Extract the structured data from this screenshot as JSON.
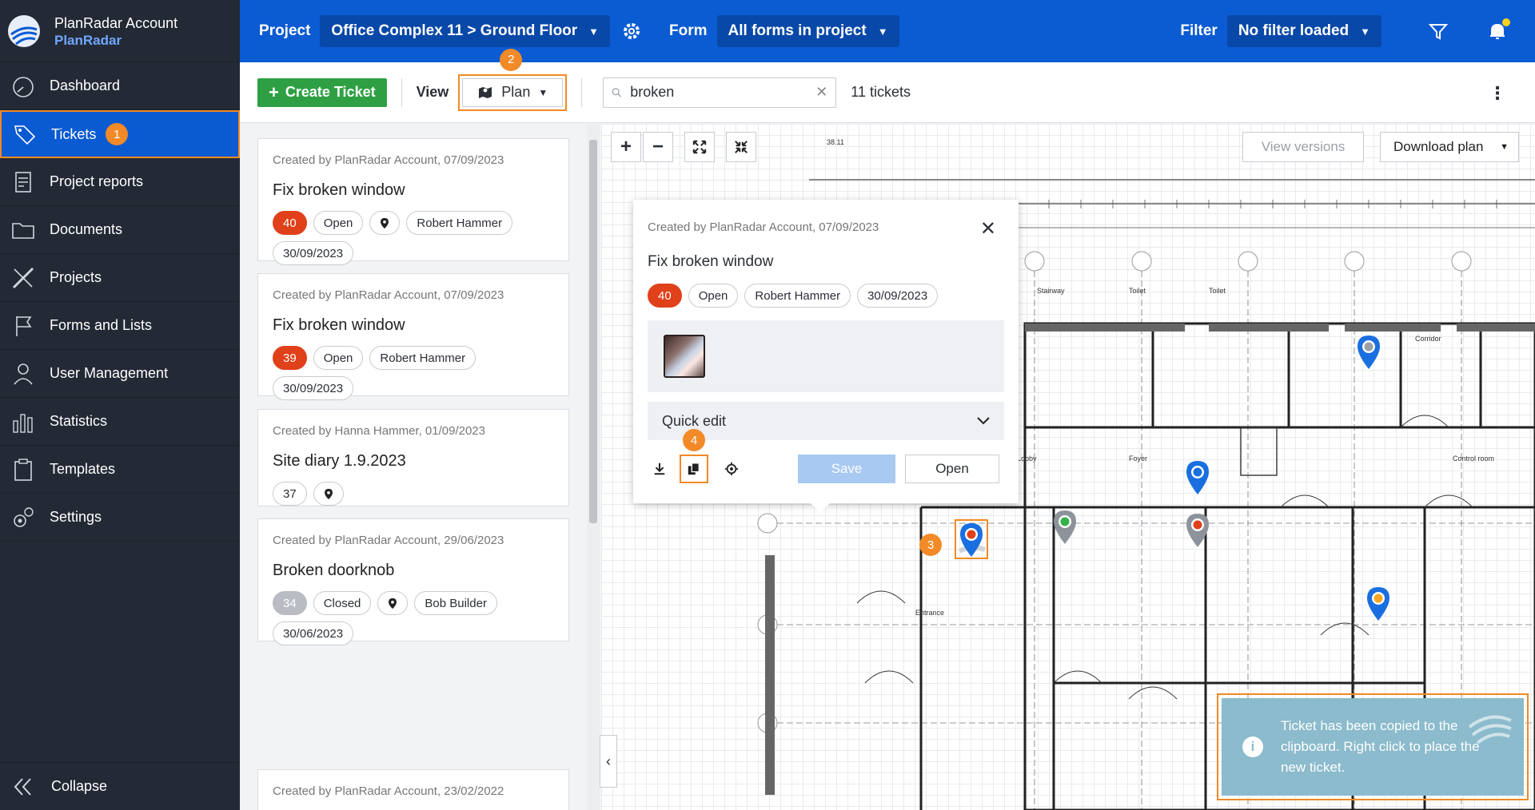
{
  "sidebar": {
    "brand_title": "PlanRadar Account",
    "brand_sub": "PlanRadar",
    "items": [
      {
        "label": "Dashboard",
        "icon": "dashboard-icon"
      },
      {
        "label": "Tickets",
        "icon": "tag-icon",
        "active": true,
        "badge": "1"
      },
      {
        "label": "Project reports",
        "icon": "report-icon"
      },
      {
        "label": "Documents",
        "icon": "folder-icon"
      },
      {
        "label": "Projects",
        "icon": "ruler-pencil-icon"
      },
      {
        "label": "Forms and Lists",
        "icon": "flag-icon"
      },
      {
        "label": "User Management",
        "icon": "user-icon"
      },
      {
        "label": "Statistics",
        "icon": "bar-chart-icon"
      },
      {
        "label": "Templates",
        "icon": "clipboard-icon"
      },
      {
        "label": "Settings",
        "icon": "gears-icon"
      }
    ],
    "collapse_label": "Collapse"
  },
  "topbar": {
    "project_label": "Project",
    "project_value": "Office Complex 11 > Ground Floor",
    "form_label": "Form",
    "form_value": "All forms in project",
    "filter_label": "Filter",
    "filter_value": "No filter loaded"
  },
  "toolbar": {
    "create_label": "Create Ticket",
    "view_label": "View",
    "view_value": "Plan",
    "view_step": "2",
    "search_value": "broken",
    "ticket_count": "11 tickets"
  },
  "tickets": [
    {
      "meta": "Created by PlanRadar Account, 07/09/2023",
      "title": "Fix broken window",
      "num": "40",
      "status": "Open",
      "assignee": "Robert Hammer",
      "date": "30/09/2023"
    },
    {
      "meta": "Created by PlanRadar Account, 07/09/2023",
      "title": "Fix broken window",
      "num": "39",
      "status": "Open",
      "assignee": "Robert Hammer",
      "date": "30/09/2023"
    },
    {
      "meta": "Created by Hanna Hammer, 01/09/2023",
      "title": "Site diary 1.9.2023",
      "num": "37"
    },
    {
      "meta": "Created by PlanRadar Account, 29/06/2023",
      "title": "Broken doorknob",
      "num": "34",
      "status": "Closed",
      "assignee": "Bob Builder",
      "date": "30/06/2023"
    },
    {
      "meta": "Created by PlanRadar Account, 23/02/2022"
    }
  ],
  "plan": {
    "view_versions": "View versions",
    "download_plan": "Download plan",
    "pin_step": "3"
  },
  "popup": {
    "meta": "Created by PlanRadar Account, 07/09/2023",
    "title": "Fix broken window",
    "num": "40",
    "status": "Open",
    "assignee": "Robert Hammer",
    "date": "30/09/2023",
    "quick_edit": "Quick edit",
    "copy_step": "4",
    "save_label": "Save",
    "open_label": "Open"
  },
  "toast": {
    "message": "Ticket has been copied to the clipboard. Right click to place the new ticket."
  },
  "colors": {
    "brand_blue": "#0b5bd3",
    "sidebar_bg": "#232a35",
    "create_green": "#2ea043",
    "highlight_orange": "#f08a24",
    "ticket_red": "#e0401a",
    "toast_teal": "#8bbbcc"
  }
}
